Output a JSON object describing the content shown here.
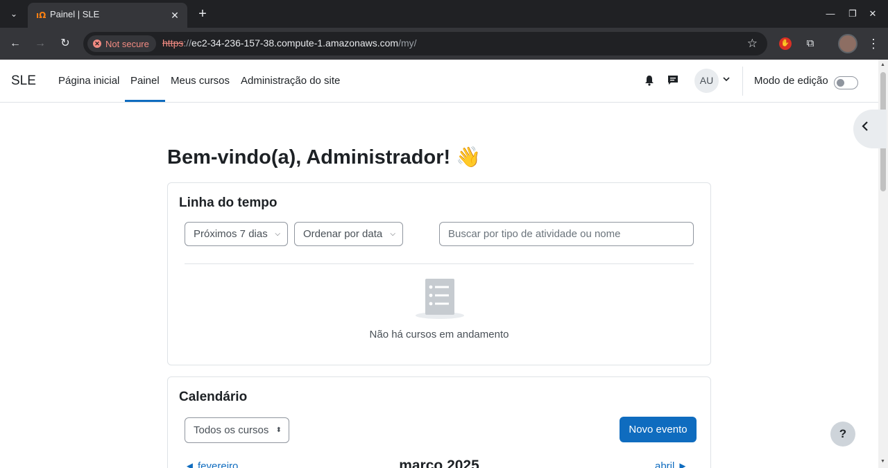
{
  "browser": {
    "tab_title": "Painel | SLE",
    "favicon_glyph": "ıΩ",
    "new_tab_glyph": "+",
    "close_glyph": "✕",
    "security_chip": "Not secure",
    "url_scheme": "https",
    "url_sep": "://",
    "url_host": "ec2-34-236-157-38.compute-1.amazonaws.com",
    "url_path": "/my/"
  },
  "navbar": {
    "brand": "SLE",
    "items": [
      {
        "label": "Página inicial"
      },
      {
        "label": "Painel",
        "active": true
      },
      {
        "label": "Meus cursos"
      },
      {
        "label": "Administração do site"
      }
    ],
    "avatar_initials": "AU",
    "edit_mode_label": "Modo de edição",
    "edit_mode_on": false,
    "accent": "#0f6cbf"
  },
  "page": {
    "title": "Bem-vindo(a), Administrador! 👋"
  },
  "timeline": {
    "title": "Linha do tempo",
    "filter_days": "Próximos 7 dias",
    "sort": "Ordenar por data",
    "search_placeholder": "Buscar por tipo de atividade ou nome",
    "empty_text": "Não há cursos em andamento"
  },
  "calendar": {
    "title": "Calendário",
    "course_filter": "Todos os cursos",
    "new_event": "Novo evento",
    "prev_month": "◄ fevereiro",
    "current_month": "março 2025",
    "next_month": "abril ►"
  },
  "help": {
    "label": "?"
  }
}
